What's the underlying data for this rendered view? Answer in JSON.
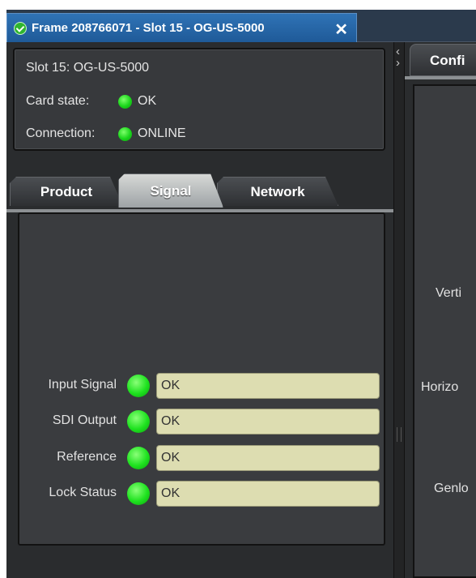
{
  "window_tab": {
    "title": "Frame 208766071 - Slot 15 - OG-US-5000",
    "close_glyph": "✕",
    "status_icon": "check-circle-icon",
    "status_color": "#2fb52f"
  },
  "card_info": {
    "slot": "Slot 15: OG-US-5000",
    "card_state_label": "Card state:",
    "card_state_value": "OK",
    "connection_label": "Connection:",
    "connection_value": "ONLINE",
    "led_color": "#19d41a"
  },
  "tabs": [
    {
      "label": "Product",
      "active": false
    },
    {
      "label": "Signal",
      "active": true
    },
    {
      "label": "Network",
      "active": false
    }
  ],
  "signal_status": [
    {
      "label": "Input Signal",
      "value": "OK"
    },
    {
      "label": "SDI Output",
      "value": "OK"
    },
    {
      "label": "Reference",
      "value": "OK"
    },
    {
      "label": "Lock Status",
      "value": "OK"
    }
  ],
  "right_panel": {
    "tab_label": "Confi",
    "labels": [
      "Verti",
      "Horizo",
      "Genlo"
    ]
  },
  "colors": {
    "field_background": "#ddddb1",
    "tab_bar": "#2b3a4c",
    "active_tab": "#1f5a98"
  }
}
